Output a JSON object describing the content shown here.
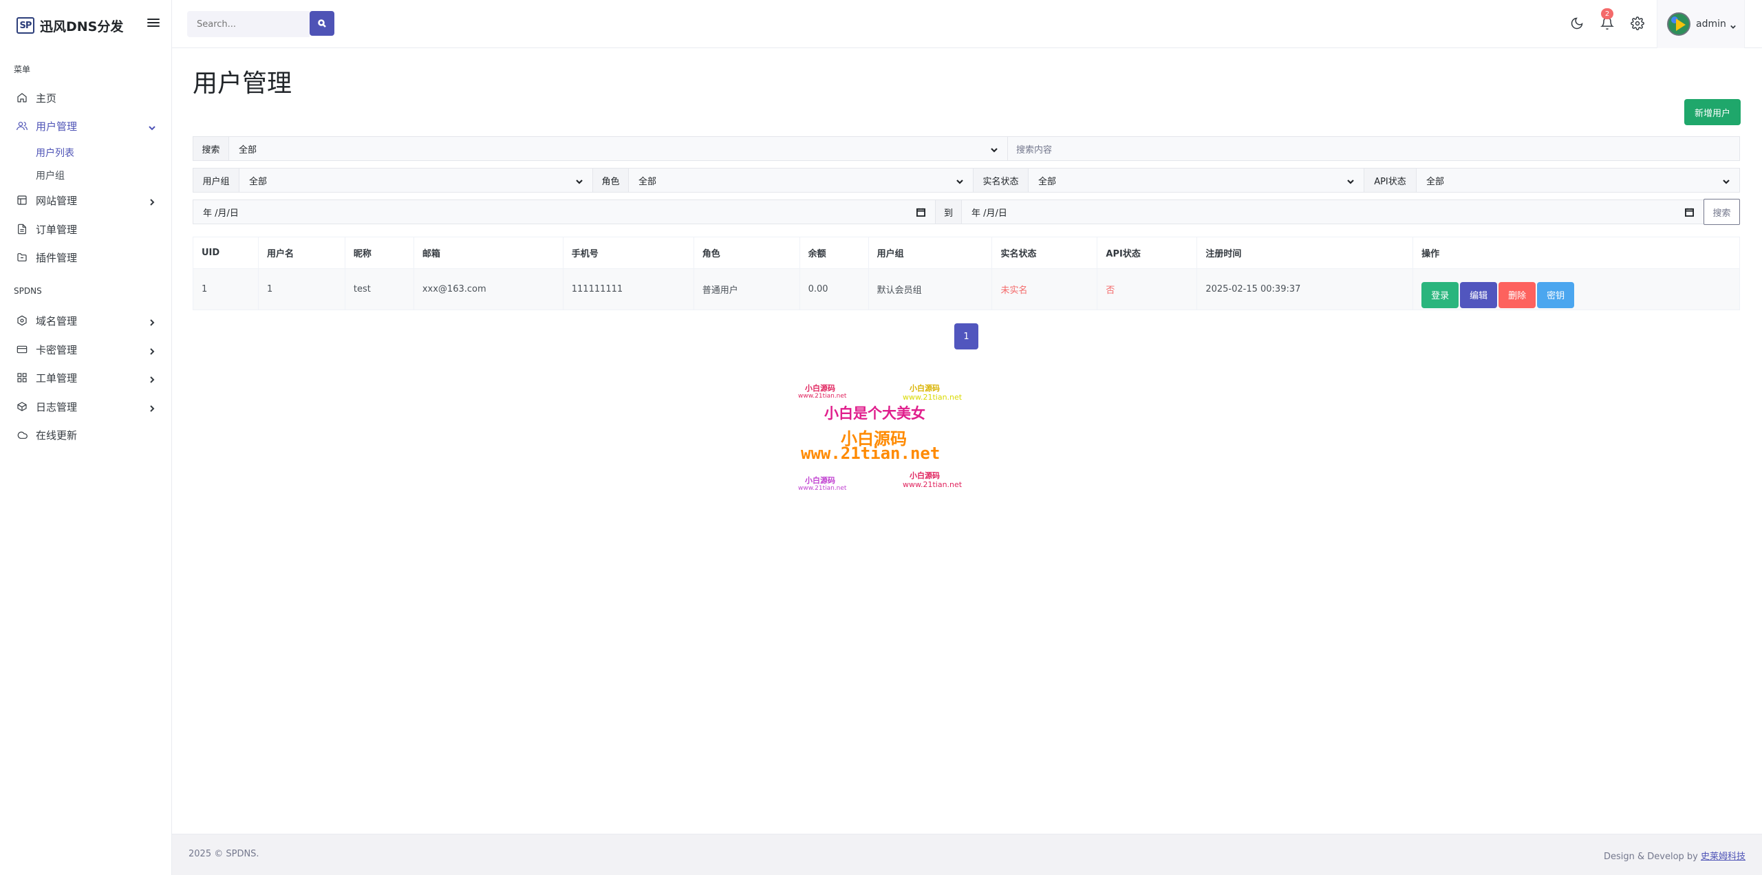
{
  "brand": {
    "logo": "SP",
    "name": "迅风DNS分发"
  },
  "sidebar": {
    "heading_menu": "菜单",
    "heading_spdns": "SPDNS",
    "items": [
      {
        "label": "主页",
        "icon": "home-icon"
      },
      {
        "label": "用户管理",
        "icon": "users-icon",
        "expanded": true
      },
      {
        "label": "网站管理",
        "icon": "layout-icon"
      },
      {
        "label": "订单管理",
        "icon": "file-icon"
      },
      {
        "label": "插件管理",
        "icon": "folder-icon"
      },
      {
        "label": "域名管理",
        "icon": "hexagon-icon"
      },
      {
        "label": "卡密管理",
        "icon": "credit-card-icon"
      },
      {
        "label": "工单管理",
        "icon": "grid-icon"
      },
      {
        "label": "日志管理",
        "icon": "box-icon"
      },
      {
        "label": "在线更新",
        "icon": "cloud-icon"
      }
    ],
    "sub_items": [
      {
        "label": "用户列表",
        "active": true
      },
      {
        "label": "用户组",
        "active": false
      }
    ]
  },
  "topbar": {
    "search_placeholder": "Search...",
    "notification_count": "2",
    "username": "admin"
  },
  "page": {
    "title": "用户管理",
    "add_button": "新增用户"
  },
  "filters": {
    "search_label": "搜索",
    "search_field_value": "全部",
    "search_placeholder": "搜索内容",
    "group_label": "用户组",
    "group_value": "全部",
    "role_label": "角色",
    "role_value": "全部",
    "realname_label": "实名状态",
    "realname_value": "全部",
    "api_label": "API状态",
    "api_value": "全部",
    "date_from": "年 /月/日",
    "date_to_label": "到",
    "date_to": "年 /月/日",
    "search_button": "搜索"
  },
  "table": {
    "headers": [
      "UID",
      "用户名",
      "昵称",
      "邮箱",
      "手机号",
      "角色",
      "余额",
      "用户组",
      "实名状态",
      "API状态",
      "注册时间",
      "操作"
    ],
    "rows": [
      [
        "1",
        "1",
        "test",
        "xxx@163.com",
        "111111111",
        "普通用户",
        "0.00",
        "默认会员组",
        "未实名",
        "否",
        "2025-02-15 00:39:37"
      ]
    ],
    "actions": [
      "登录",
      "编辑",
      "删除",
      "密钥"
    ]
  },
  "pagination": {
    "current": "1"
  },
  "watermark": {
    "small_top_left": "小白源码",
    "small_url_top_left": "www.21tian.net",
    "small_top_right": "小白源码",
    "small_url_top_right": "www.21tian.net",
    "main_line1": "小白是个大美女",
    "main_line2": "小白源码",
    "main_line3": "www.21tian.net",
    "small_bottom_left": "小白源码",
    "small_url_bottom_left": "www.21tian.net",
    "small_bottom_right": "小白源码",
    "small_url_bottom_right": "www.21tian.net"
  },
  "footer": {
    "copyright": "2025 © SPDNS.",
    "credit_prefix": "Design & Develop by ",
    "credit_link": "史莱姆科技"
  },
  "colors": {
    "accent": "#4e53b6",
    "success": "#2ab57d",
    "danger": "#fd625e",
    "info": "#4ba6ef",
    "badge": "#f46a6a"
  }
}
